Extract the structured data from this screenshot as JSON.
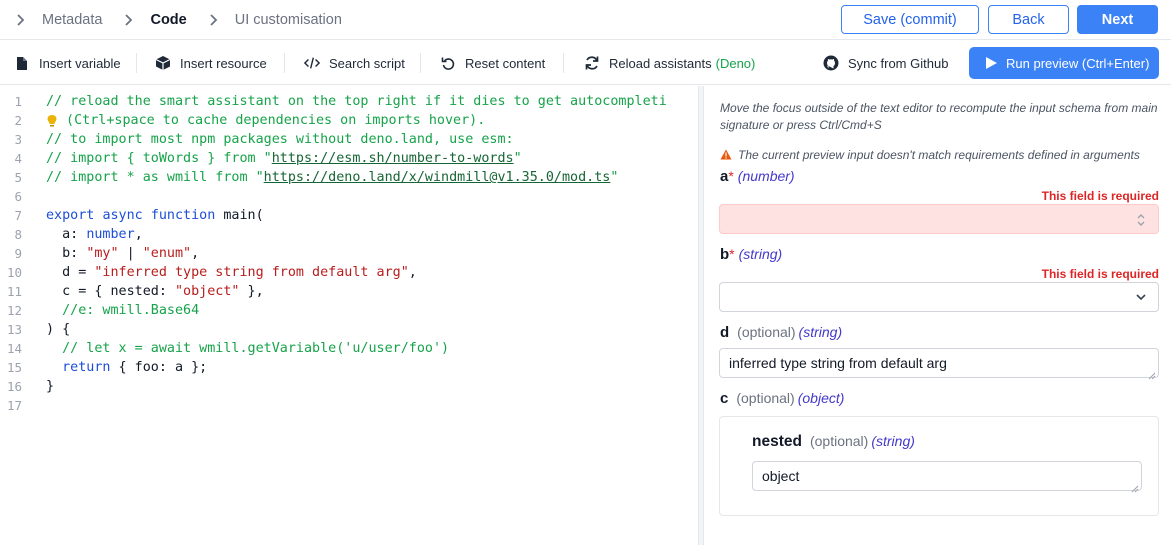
{
  "breadcrumbs": [
    {
      "label": "Metadata",
      "active": false
    },
    {
      "label": "Code",
      "active": true
    },
    {
      "label": "UI customisation",
      "active": false
    }
  ],
  "header_buttons": {
    "commit": "Save (commit)",
    "back": "Back",
    "next": "Next"
  },
  "toolbar": {
    "insert_variable": "Insert variable",
    "insert_resource": "Insert resource",
    "search_script": "Search script",
    "reset_content": "Reset content",
    "reload_assistants": "Reload assistants",
    "reload_assistants_runtime": "(Deno)",
    "sync_github": "Sync from Github",
    "run_preview": "Run preview (Ctrl+Enter)"
  },
  "editor": {
    "line_numbers": [
      "1",
      "2",
      "3",
      "4",
      "5",
      "6",
      "7",
      "8",
      "9",
      "10",
      "11",
      "12",
      "13",
      "14",
      "15",
      "16",
      "17"
    ],
    "code": {
      "l1": "// reload the smart assistant on the top right if it dies to get autocompleti",
      "l2": " (Ctrl+space to cache dependencies on imports hover).",
      "l3": "// to import most npm packages without deno.land, use esm:",
      "l4_pre": "// import { toWords } from \"",
      "l4_link": "https://esm.sh/number-to-words",
      "l4_post": "\"",
      "l5_pre": "// import * as wmill from \"",
      "l5_link": "https://deno.land/x/windmill@v1.35.0/mod.ts",
      "l5_post": "\"",
      "l7_kw1": "export",
      "l7_kw2": "async",
      "l7_kw3": "function",
      "l7_rest": " main(",
      "l8_a": "  a: ",
      "l8_type": "number",
      "l8_comma": ",",
      "l9_a": "  b: ",
      "l9_s1": "\"my\"",
      "l9_pipe": " | ",
      "l9_s2": "\"enum\"",
      "l9_comma": ",",
      "l10_a": "  d = ",
      "l10_s": "\"inferred type string from default arg\"",
      "l10_comma": ",",
      "l11_a": "  c = { nested: ",
      "l11_s": "\"object\"",
      "l11_b": " },",
      "l12": "  //e: wmill.Base64",
      "l13": ") {",
      "l14": "  // let x = await wmill.getVariable('u/user/foo')",
      "l15_kw": "return",
      "l15_rest": " { foo: a };",
      "l16": "}"
    }
  },
  "panel": {
    "hint": "Move the focus outside of the text editor to recompute the input schema from main signature or press Ctrl/Cmd+S",
    "warning": "The current preview input doesn't match requirements defined in arguments",
    "required_msg": "This field is required",
    "fields": {
      "a": {
        "name": "a",
        "star": "*",
        "type": "(number)"
      },
      "b": {
        "name": "b",
        "star": "*",
        "type": "(string)"
      },
      "d": {
        "name": "d",
        "optional": "(optional)",
        "type": "(string)",
        "value": "inferred type string from default arg"
      },
      "c": {
        "name": "c",
        "optional": "(optional)",
        "type": "(object)"
      },
      "nested": {
        "name": "nested",
        "optional": "(optional)",
        "type": "(string)",
        "value": "object"
      }
    }
  },
  "colors": {
    "primary": "#3b82f6",
    "error": "#dc2626",
    "comment": "#16a34a",
    "keyword": "#1d4ed8",
    "string": "#b91c1c"
  }
}
